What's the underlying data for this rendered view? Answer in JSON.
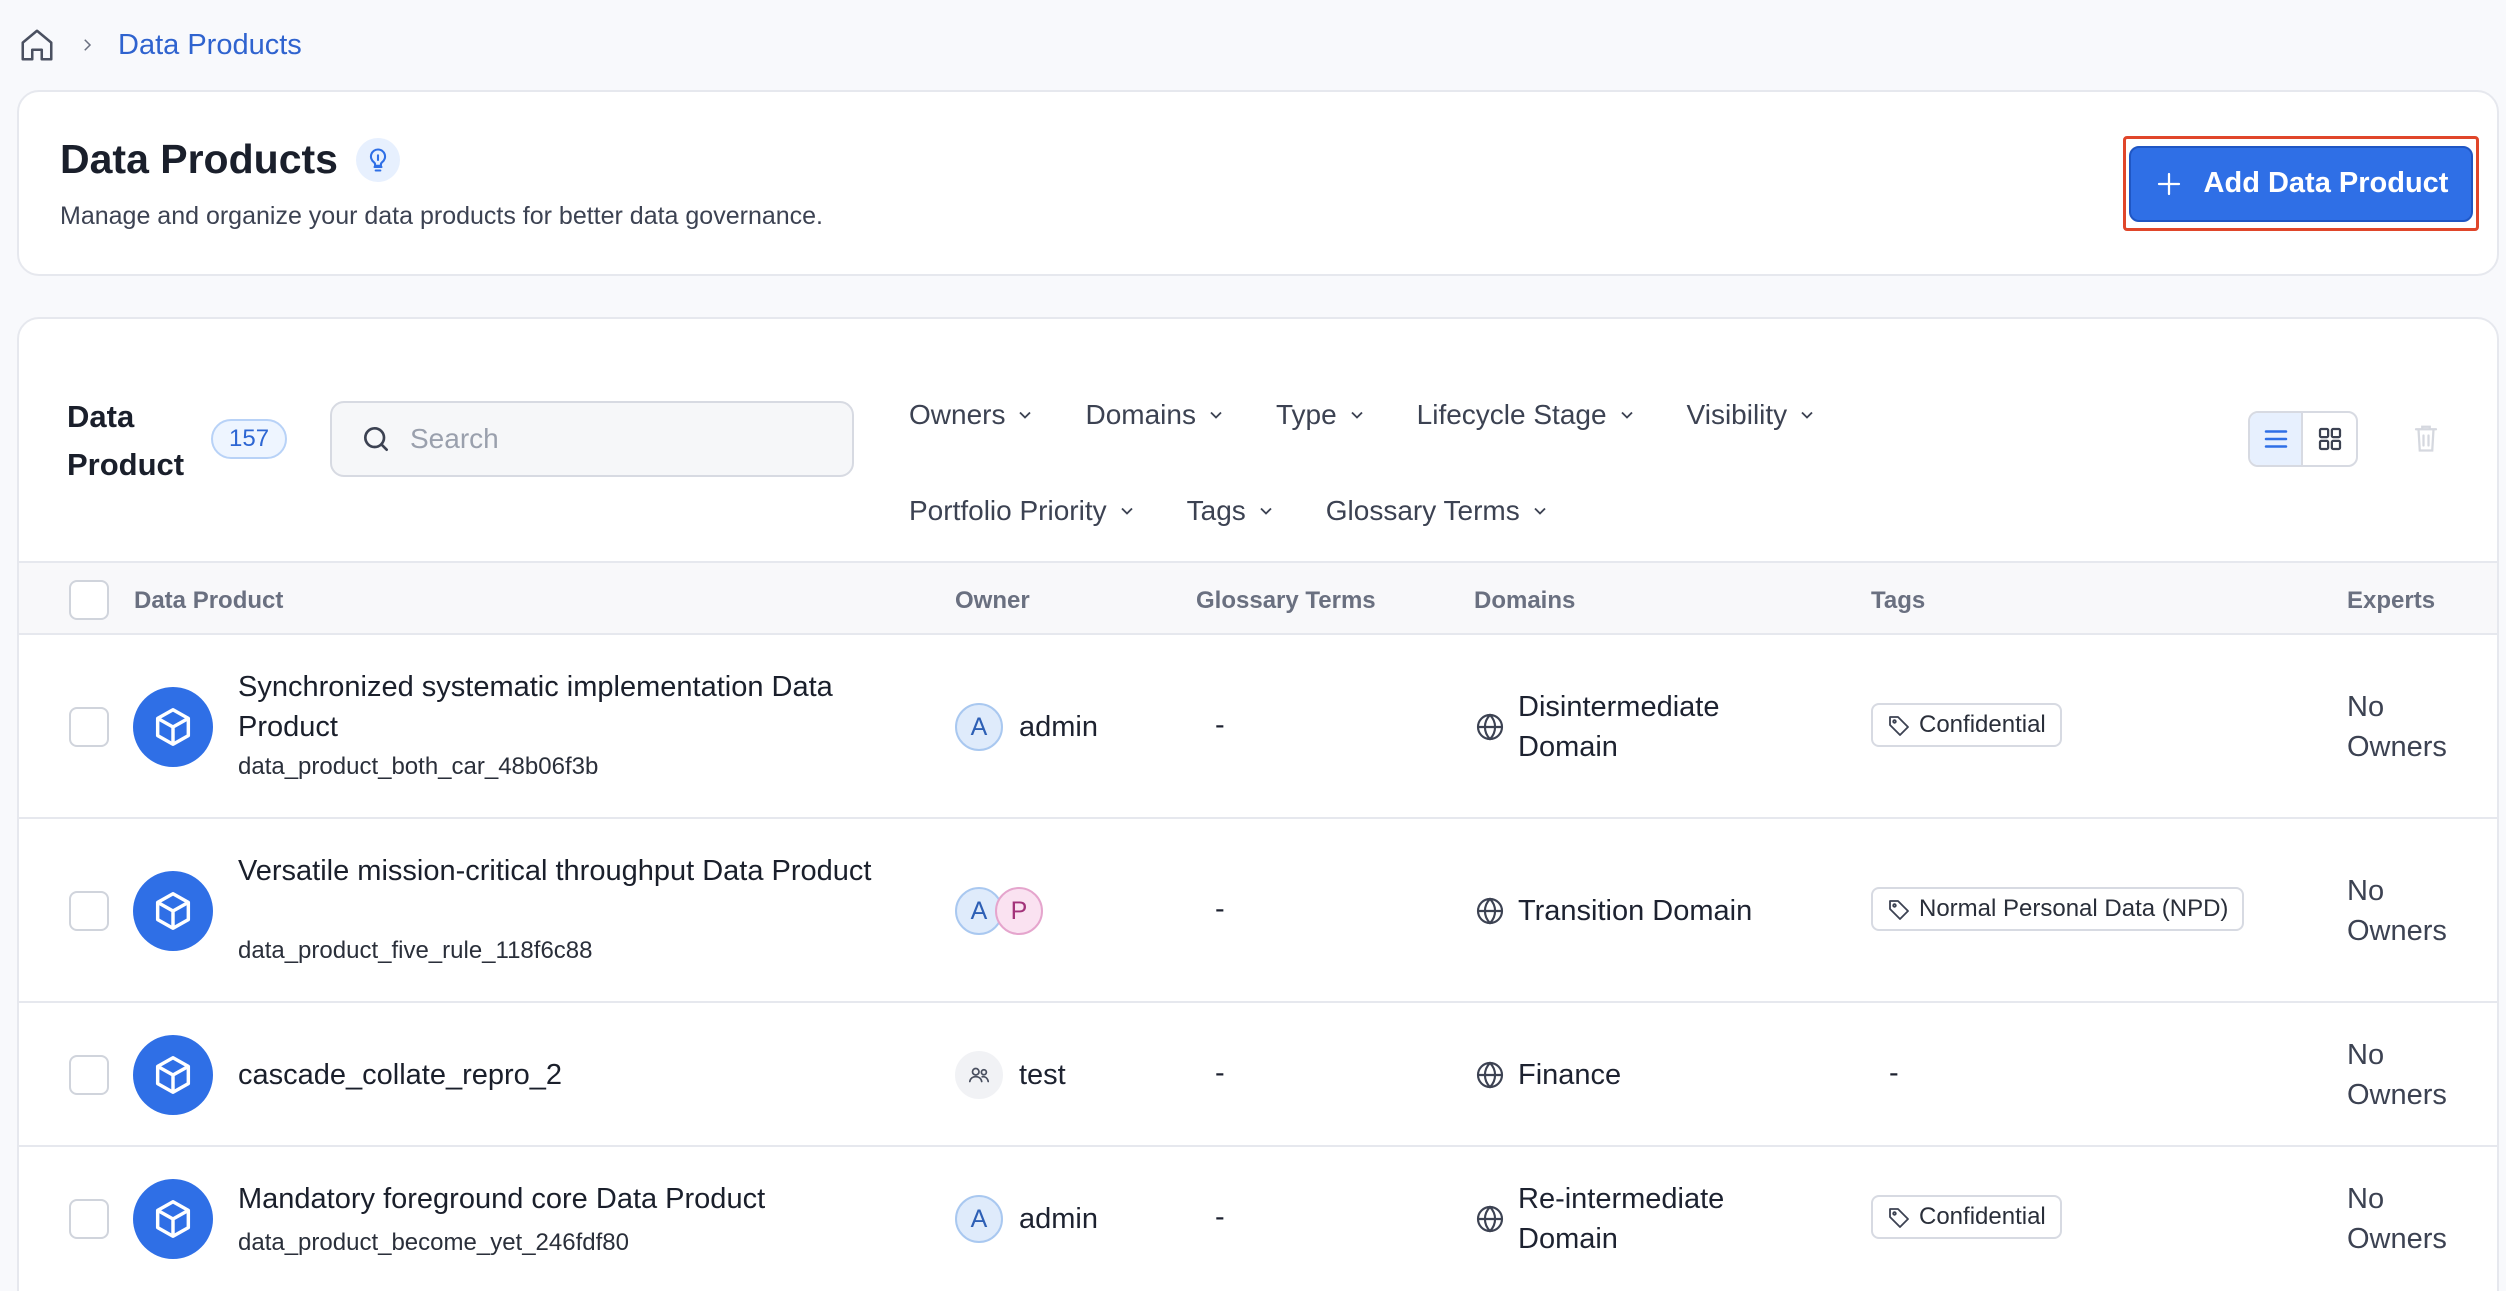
{
  "breadcrumb": {
    "current": "Data Products"
  },
  "header": {
    "title": "Data Products",
    "subtitle": "Manage and organize your data products for better data governance.",
    "add_button": "Add Data Product"
  },
  "toolbar": {
    "entity_label": "Data Product",
    "count": "157",
    "search_placeholder": "Search",
    "filters_row1": [
      "Owners",
      "Domains",
      "Type",
      "Lifecycle Stage",
      "Visibility"
    ],
    "filters_row2": [
      "Portfolio Priority",
      "Tags",
      "Glossary Terms"
    ]
  },
  "table": {
    "columns": [
      "Data Product",
      "Owner",
      "Glossary Terms",
      "Domains",
      "Tags",
      "Experts"
    ],
    "rows": [
      {
        "name": "Synchronized systematic implementation Data Product",
        "id": "data_product_both_car_48b06f3b",
        "owner_initials": [
          "A"
        ],
        "owner_name": "admin",
        "glossary": "-",
        "domain": "Disintermediate Domain",
        "tag": "Confidential",
        "experts": "No Owners"
      },
      {
        "name": "Versatile mission-critical throughput Data Product",
        "id": "data_product_five_rule_118f6c88",
        "owner_initials": [
          "A",
          "P"
        ],
        "owner_name": "",
        "glossary": "-",
        "domain": "Transition Domain",
        "tag": "Normal Personal Data (NPD)",
        "experts": "No Owners"
      },
      {
        "name": "cascade_collate_repro_2",
        "id": "",
        "owner_initials": [],
        "owner_name": "test",
        "glossary": "-",
        "domain": "Finance",
        "tag": "-",
        "experts": "No Owners"
      },
      {
        "name": "Mandatory foreground core Data Product",
        "id": "data_product_become_yet_246fdf80",
        "owner_initials": [
          "A"
        ],
        "owner_name": "admin",
        "glossary": "-",
        "domain": "Re-intermediate Domain",
        "tag": "Confidential",
        "experts": "No Owners"
      }
    ]
  },
  "colors": {
    "primary": "#2f6fe6",
    "highlight": "#e0462a",
    "link": "#2f63cf"
  }
}
